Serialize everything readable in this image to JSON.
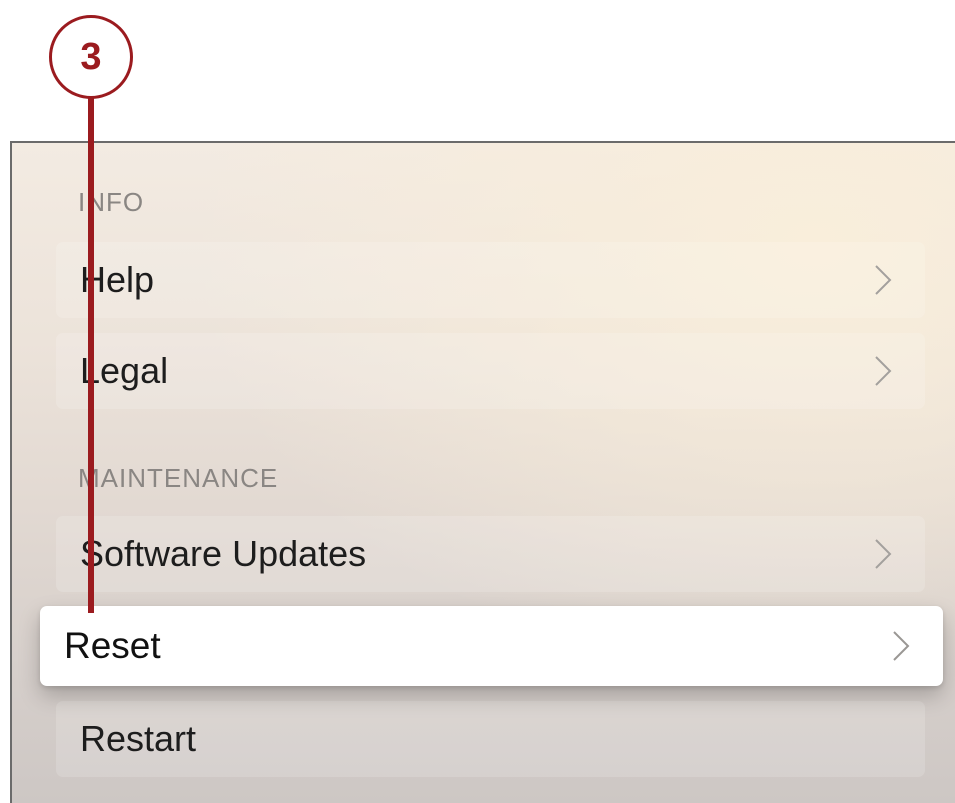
{
  "callout": {
    "number": "3",
    "color": "#9b1b1f"
  },
  "sections": [
    {
      "header": "INFO",
      "items": [
        {
          "label": "Help",
          "icon": "chevron-right-icon"
        },
        {
          "label": "Legal",
          "icon": "chevron-right-icon"
        }
      ]
    },
    {
      "header": "MAINTENANCE",
      "items": [
        {
          "label": "Software Updates",
          "icon": "chevron-right-icon"
        },
        {
          "label": "Reset",
          "icon": "chevron-right-icon",
          "focused": true
        },
        {
          "label": "Restart"
        }
      ]
    }
  ]
}
